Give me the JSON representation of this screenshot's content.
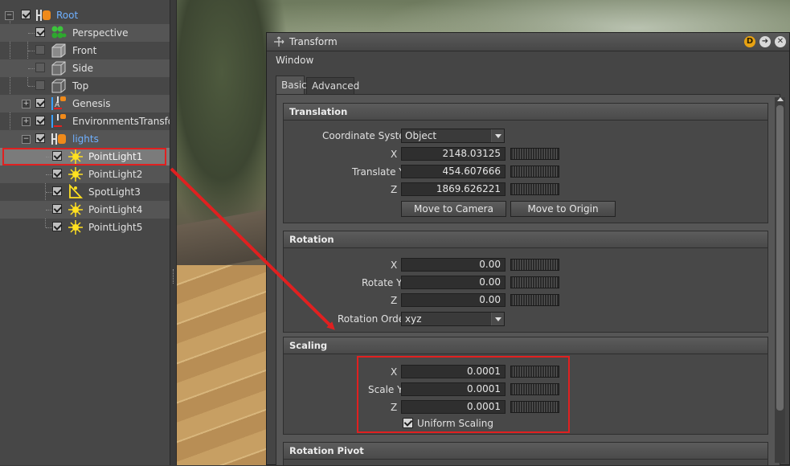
{
  "tree": {
    "items": [
      {
        "label": "Root",
        "expander": "−",
        "checked": true,
        "icon": "group-icon",
        "blue": true
      },
      {
        "label": "Perspective",
        "checked": true,
        "icon": "perspective-camera-icon"
      },
      {
        "label": "Front",
        "checked": false,
        "icon": "front-camera-icon"
      },
      {
        "label": "Side",
        "checked": false,
        "icon": "side-camera-icon"
      },
      {
        "label": "Top",
        "checked": false,
        "icon": "top-camera-icon"
      },
      {
        "label": "Genesis",
        "expander": "+",
        "checked": true,
        "icon": "transform-icon"
      },
      {
        "label": "EnvironmentsTransform",
        "expander": "+",
        "checked": true,
        "icon": "transform-icon"
      },
      {
        "label": "lights",
        "expander": "−",
        "checked": true,
        "icon": "group-icon",
        "blue": true
      },
      {
        "label": "PointLight1",
        "checked": true,
        "icon": "point-light-icon",
        "selected": true
      },
      {
        "label": "PointLight2",
        "checked": true,
        "icon": "point-light-icon"
      },
      {
        "label": "SpotLight3",
        "checked": true,
        "icon": "spot-light-icon"
      },
      {
        "label": "PointLight4",
        "checked": true,
        "icon": "point-light-icon"
      },
      {
        "label": "PointLight5",
        "checked": true,
        "icon": "point-light-icon"
      }
    ]
  },
  "window": {
    "title": "Transform",
    "menu": "Window",
    "dock_button": "D",
    "tabs": [
      "Basic",
      "Advanced"
    ],
    "active_tab": "Basic"
  },
  "translation": {
    "header": "Translation",
    "coord_label": "Coordinate System",
    "coord_value": "Object",
    "x_label": "X",
    "y_label": "Translate Y",
    "z_label": "Z",
    "x": "2148.03125",
    "y": "454.607666",
    "z": "1869.626221",
    "move_camera": "Move to Camera",
    "move_origin": "Move to Origin"
  },
  "rotation": {
    "header": "Rotation",
    "x_label": "X",
    "y_label": "Rotate Y",
    "z_label": "Z",
    "x": "0.00",
    "y": "0.00",
    "z": "0.00",
    "order_label": "Rotation Order",
    "order_value": "xyz"
  },
  "scaling": {
    "header": "Scaling",
    "x_label": "X",
    "y_label": "Scale Y",
    "z_label": "Z",
    "x": "0.0001",
    "y": "0.0001",
    "z": "0.0001",
    "uniform_label": "Uniform Scaling",
    "uniform_checked": true
  },
  "rotation_pivot": {
    "header": "Rotation Pivot"
  },
  "colors": {
    "annotation": "#e02020",
    "dock_button": "#e8a212",
    "group_icon": "#f08a1a",
    "light_icon": "#ffe020"
  }
}
